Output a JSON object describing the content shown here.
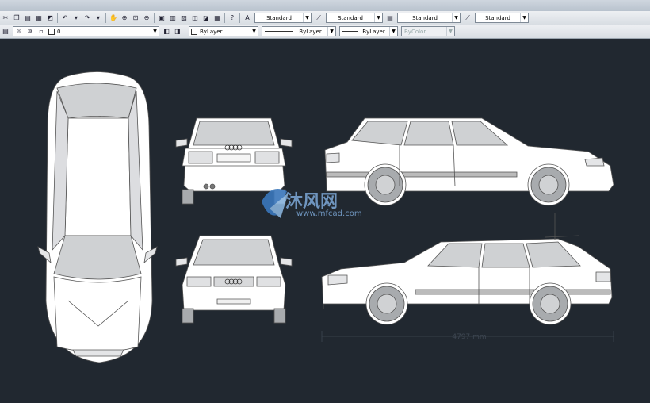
{
  "styles_toolbar": {
    "text_style": "Standard",
    "dim_style": "Standard",
    "table_style": "Standard",
    "mleader_style": "Standard"
  },
  "layers_toolbar": {
    "current_layer": "0"
  },
  "properties_toolbar": {
    "color": "ByLayer",
    "linetype": "ByLayer",
    "lineweight": "ByLayer",
    "plotstyle": "ByColor"
  },
  "drawing": {
    "dimension_text": "4797 mm"
  },
  "watermark": {
    "brand_cn": "沐风网",
    "url": "www.mfcad.com"
  },
  "colors": {
    "canvas": "#212830",
    "car_fill": "#ffffff",
    "glass": "#cfd1d3",
    "wheel": "#a8abae",
    "stroke": "#555555"
  }
}
